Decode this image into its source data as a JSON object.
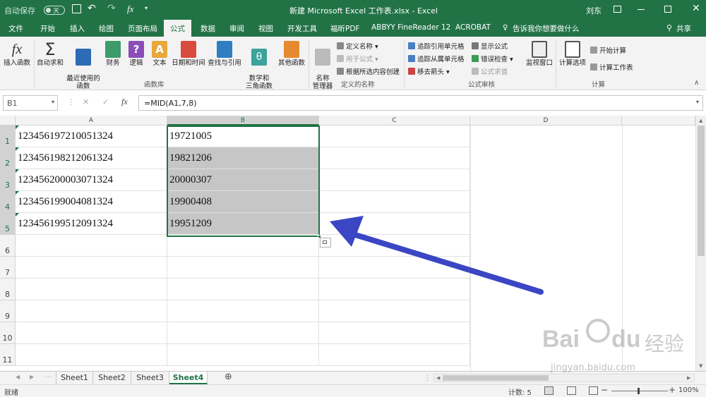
{
  "titlebar": {
    "autosave": "自动保存",
    "toggle": "关",
    "title": "新建 Microsoft Excel 工作表.xlsx  -  Excel",
    "user": "刘东",
    "qa_fx": "fx"
  },
  "tabs": [
    "文件",
    "开始",
    "插入",
    "绘图",
    "页面布局",
    "公式",
    "数据",
    "审阅",
    "视图",
    "开发工具",
    "福昕PDF",
    "ABBYY FineReader 12",
    "ACROBAT"
  ],
  "tell": "告诉我你想要做什么",
  "share": "共享",
  "ribbon": {
    "insert_fn": "插入函数",
    "autosum": "自动求和",
    "recent": "最近使用的\n函数",
    "finance": "财务",
    "logic": "逻辑",
    "text": "文本",
    "datetime": "日期和时间",
    "lookup": "查找与引用",
    "math": "数学和\n三角函数",
    "other": "其他函数",
    "grp_lib": "函数库",
    "name_mgr": "名称\n管理器",
    "define_name": "定义名称",
    "use_in_formula": "用于公式",
    "create_from_sel": "根据所选内容创建",
    "grp_names": "定义的名称",
    "trace_prec": "追踪引用单元格",
    "trace_dep": "追踪从属单元格",
    "remove_arrows": "移去箭头",
    "show_formulas": "显示公式",
    "error_check": "错误检查",
    "eval_formula": "公式求值",
    "grp_audit": "公式审核",
    "watch": "监视窗口",
    "calc_opts": "计算选项",
    "calc_now": "开始计算",
    "calc_sheet": "计算工作表",
    "grp_calc": "计算",
    "fx_glyph": "fx",
    "sigma_glyph": "Σ",
    "theta_glyph": "θ",
    "question_glyph": "?",
    "a_glyph": "A"
  },
  "formula": {
    "name_box": "B1",
    "x": "✕",
    "check": "✓",
    "fx": "fx",
    "content": "=MID(A1,7,8)"
  },
  "columns": [
    "A",
    "B",
    "C",
    "D"
  ],
  "rows": [
    "1",
    "2",
    "3",
    "4",
    "5",
    "6",
    "7",
    "8",
    "9",
    "10",
    "11"
  ],
  "cells": [
    {
      "a": "123456197210051324",
      "b": "19721005"
    },
    {
      "a": "123456198212061324",
      "b": "19821206"
    },
    {
      "a": "123456200003071324",
      "b": "20000307"
    },
    {
      "a": "123456199004081324",
      "b": "19900408"
    },
    {
      "a": "123456199512091324",
      "b": "19951209"
    }
  ],
  "sheets": [
    "Sheet1",
    "Sheet2",
    "Sheet3",
    "Sheet4"
  ],
  "active_sheet": "Sheet4",
  "add_sheet": "⊕",
  "status": {
    "mode": "就绪",
    "count": "计数: 5",
    "zoom": "100%",
    "minus": "−",
    "plus": "+"
  },
  "watermark": {
    "brand": "Bai",
    "brand2": "du",
    "cn": "经验",
    "url": "jingyan.baidu.com"
  },
  "colors": {
    "excel_green": "#217346",
    "arrow": "#3b46c4",
    "selection": "#c6c6c6"
  }
}
